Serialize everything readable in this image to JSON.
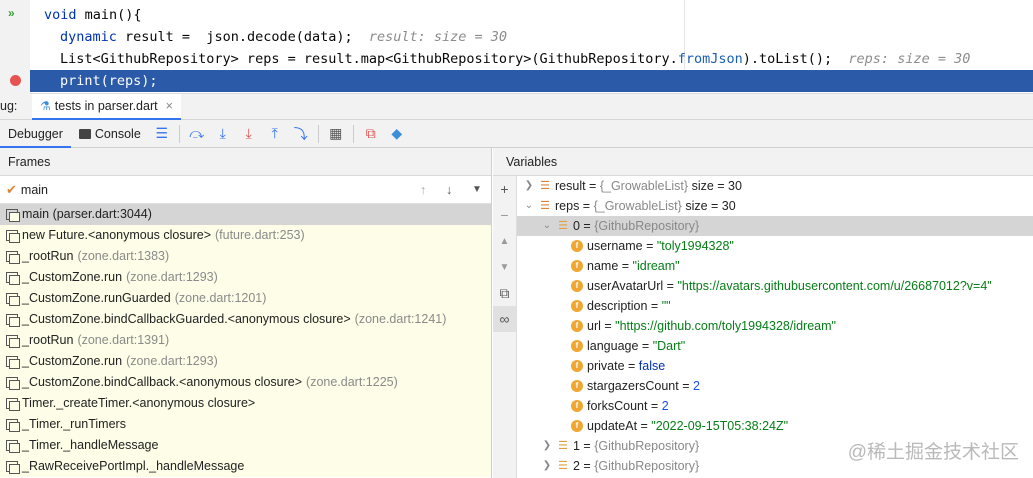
{
  "editor": {
    "lines": [
      {
        "kw": "void",
        "text": " main(){",
        "hint": ""
      },
      {
        "kw": "dynamic",
        "text": " result =  json.decode(data);",
        "hint": "result: size = 30"
      },
      {
        "kw": "",
        "text": "List<GithubRepository> reps = result.map<GithubRepository>(GithubRepository.",
        "ref": "fromJson",
        "text2": ").toList();",
        "hint": "reps: size = 30"
      },
      {
        "kw": "",
        "text": "print(reps);",
        "hint": ""
      }
    ]
  },
  "tabbar": {
    "prefix": "ug:",
    "tab_label": "tests in parser.dart",
    "close": "×"
  },
  "toolbar": {
    "debugger_label": "Debugger",
    "console_label": "Console"
  },
  "frames": {
    "title": "Frames",
    "thread": "main",
    "items": [
      {
        "name": "main (parser.dart:3044)",
        "loc": ""
      },
      {
        "name": "new Future.<anonymous closure>",
        "loc": "(future.dart:253)"
      },
      {
        "name": "_rootRun",
        "loc": "(zone.dart:1383)"
      },
      {
        "name": "_CustomZone.run",
        "loc": "(zone.dart:1293)"
      },
      {
        "name": "_CustomZone.runGuarded",
        "loc": "(zone.dart:1201)"
      },
      {
        "name": "_CustomZone.bindCallbackGuarded.<anonymous closure>",
        "loc": "(zone.dart:1241)"
      },
      {
        "name": "_rootRun",
        "loc": "(zone.dart:1391)"
      },
      {
        "name": "_CustomZone.run",
        "loc": "(zone.dart:1293)"
      },
      {
        "name": "_CustomZone.bindCallback.<anonymous closure>",
        "loc": "(zone.dart:1225)"
      },
      {
        "name": "Timer._createTimer.<anonymous closure>",
        "loc": ""
      },
      {
        "name": "_Timer._runTimers",
        "loc": ""
      },
      {
        "name": "_Timer._handleMessage",
        "loc": ""
      },
      {
        "name": "_RawReceivePortImpl._handleMessage",
        "loc": ""
      }
    ]
  },
  "variables": {
    "title": "Variables",
    "result": {
      "name": "result",
      "type": "{_GrowableList}",
      "size": "size = 30"
    },
    "reps": {
      "name": "reps",
      "type": "{_GrowableList}",
      "size": "size = 30"
    },
    "item0": {
      "idx": "0",
      "type": "{GithubRepository}"
    },
    "fields": [
      {
        "name": "username",
        "value": "\"toly1994328\"",
        "kind": "str"
      },
      {
        "name": "name",
        "value": "\"idream\"",
        "kind": "str"
      },
      {
        "name": "userAvatarUrl",
        "value": "\"https://avatars.githubusercontent.com/u/26687012?v=4\"",
        "kind": "str"
      },
      {
        "name": "description",
        "value": "\"\"",
        "kind": "str"
      },
      {
        "name": "url",
        "value": "\"https://github.com/toly1994328/idream\"",
        "kind": "str"
      },
      {
        "name": "language",
        "value": "\"Dart\"",
        "kind": "str"
      },
      {
        "name": "private",
        "value": "false",
        "kind": "kw"
      },
      {
        "name": "stargazersCount",
        "value": "2",
        "kind": "num"
      },
      {
        "name": "forksCount",
        "value": "2",
        "kind": "num"
      },
      {
        "name": "updateAt",
        "value": "\"2022-09-15T05:38:24Z\"",
        "kind": "str"
      }
    ],
    "item1": {
      "idx": "1",
      "type": "{GithubRepository}"
    },
    "item2": {
      "idx": "2",
      "type": "{GithubRepository}"
    }
  },
  "watermark": "@稀土掘金技术社区",
  "colors": {
    "accent": "#3574f0",
    "selection": "#2a5aa8",
    "string": "#067d17",
    "number": "#1750eb"
  }
}
